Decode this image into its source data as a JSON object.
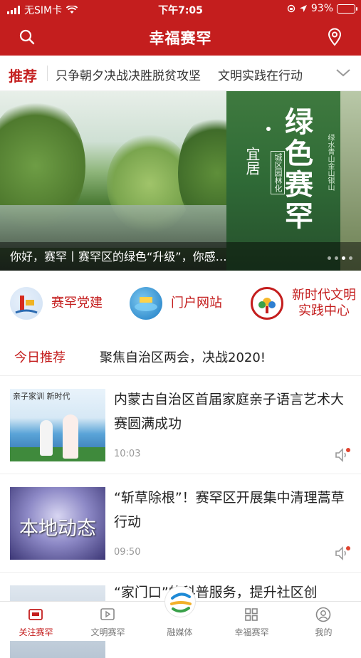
{
  "status": {
    "carrier": "无SIM卡",
    "time": "下午7:05",
    "battery": "93%",
    "battery_level": 0.93
  },
  "header": {
    "title": "幸福赛罕"
  },
  "ticker": {
    "tag": "推荐",
    "items": [
      "只争朝夕决战决胜脱贫攻坚",
      "文明实践在行动"
    ]
  },
  "banner": {
    "caption": "你好，赛罕丨赛罕区的绿色“升级”，你感…",
    "poster_big": "绿色赛罕",
    "poster_small": "宜居",
    "poster_side": "城区园林化",
    "poster_right": "绿水青山金山银山",
    "page_dots": 4,
    "active_dot": 2
  },
  "shortcuts": [
    {
      "label": "赛罕党建",
      "icon": "party-building-icon"
    },
    {
      "label": "门户网站",
      "icon": "portal-globe-icon"
    },
    {
      "label": "新时代文明\n实践中心",
      "line1": "新时代文明",
      "line2": "实践中心",
      "icon": "civilization-center-icon"
    }
  ],
  "today": {
    "tag": "今日推荐",
    "text": "聚焦自治区两会，决战2020!"
  },
  "news": [
    {
      "title": "内蒙古自治区首届家庭亲子语言艺术大赛圆满成功",
      "time": "10:03",
      "thumb_text": "亲子家训 新时代"
    },
    {
      "title": "“斩草除根”！赛罕区开展集中清理蒿草行动",
      "time": "09:50",
      "thumb_text": "本地动态"
    },
    {
      "title": "“家门口”的科普服务，提升社区创",
      "time": ""
    }
  ],
  "tabbar": {
    "items": [
      {
        "label": "关注赛罕",
        "icon": "news-icon",
        "active": true
      },
      {
        "label": "文明赛罕",
        "icon": "video-play-icon",
        "active": false
      },
      {
        "label": "融媒体",
        "icon": "media-logo-icon",
        "active": false
      },
      {
        "label": "幸福赛罕",
        "icon": "grid-apps-icon",
        "active": false
      },
      {
        "label": "我的",
        "icon": "user-profile-icon",
        "active": false
      }
    ]
  },
  "colors": {
    "brand_red": "#c41e1e",
    "muted_text": "#777777"
  }
}
